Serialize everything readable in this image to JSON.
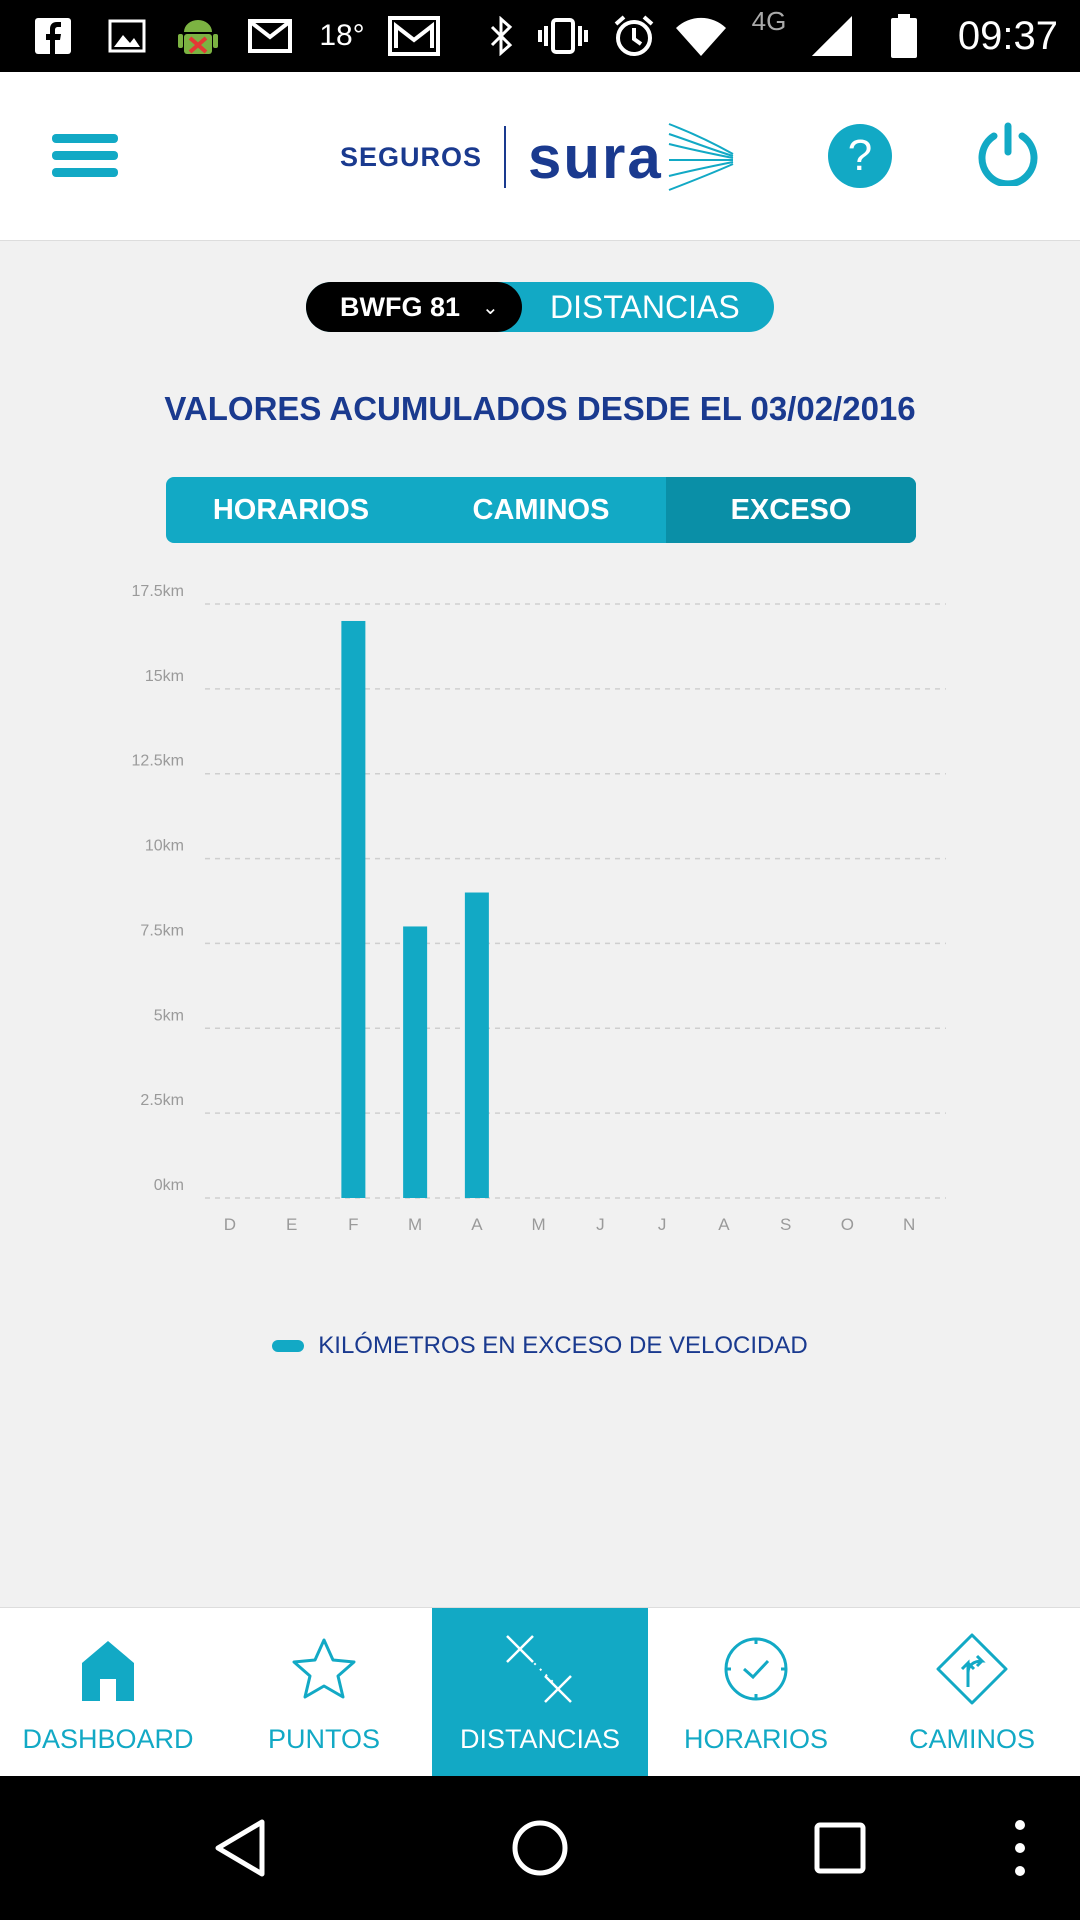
{
  "status_bar": {
    "temperature": "18°",
    "network": "4G",
    "time": "09:37",
    "icons": [
      "facebook-icon",
      "gallery-icon",
      "android-debug-icon",
      "gmail-icon",
      "gmail-icon",
      "bluetooth-icon",
      "vibrate-icon",
      "alarm-icon",
      "wifi-icon",
      "signal-icon",
      "battery-icon"
    ]
  },
  "header": {
    "brand_left": "SEGUROS",
    "brand_right": "sura",
    "help_label": "?",
    "accent": "#12a9c5",
    "brand_color": "#1a3a8f"
  },
  "selector": {
    "vehicle": "BWFG 81",
    "section": "DISTANCIAS"
  },
  "heading": "VALORES ACUMULADOS DESDE EL 03/02/2016",
  "tabs": [
    {
      "label": "HORARIOS",
      "active": false
    },
    {
      "label": "CAMINOS",
      "active": false
    },
    {
      "label": "EXCESO",
      "active": true
    }
  ],
  "chart_data": {
    "type": "bar",
    "categories": [
      "D",
      "E",
      "F",
      "M",
      "A",
      "M",
      "J",
      "J",
      "A",
      "S",
      "O",
      "N"
    ],
    "series": [
      {
        "name": "KILÓMETROS EN EXCESO DE VELOCIDAD",
        "values": [
          0,
          0,
          17,
          8,
          9,
          0,
          0,
          0,
          0,
          0,
          0,
          0
        ],
        "color": "#12a9c5"
      }
    ],
    "y_ticks": [
      "0km",
      "2.5km",
      "5km",
      "7.5km",
      "10km",
      "12.5km",
      "15km",
      "17.5km"
    ],
    "ylim": [
      0,
      17.5
    ],
    "grid": true,
    "legend_position": "bottom"
  },
  "legend": {
    "label": "KILÓMETROS EN EXCESO DE VELOCIDAD"
  },
  "bottom_nav": [
    {
      "label": "DASHBOARD",
      "icon": "home-icon",
      "active": false
    },
    {
      "label": "PUNTOS",
      "icon": "star-icon",
      "active": false
    },
    {
      "label": "DISTANCIAS",
      "icon": "distance-icon",
      "active": true
    },
    {
      "label": "HORARIOS",
      "icon": "clock-icon",
      "active": false
    },
    {
      "label": "CAMINOS",
      "icon": "route-icon",
      "active": false
    }
  ]
}
